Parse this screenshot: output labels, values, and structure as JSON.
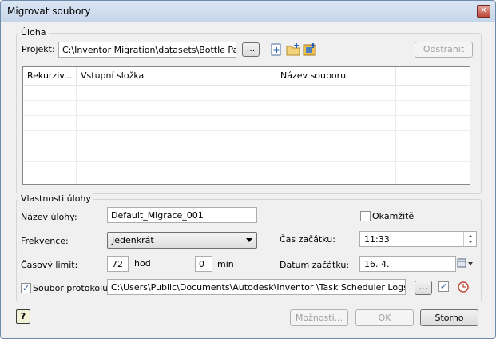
{
  "window": {
    "title": "Migrovat soubory",
    "close_glyph": "✕"
  },
  "task_group": {
    "label": "Úloha",
    "project_label": "Projekt:",
    "project_value": "C:\\Inventor Migration\\datasets\\Bottle Packag",
    "browse_label": "...",
    "remove_label": "Odstranit",
    "icons": [
      "add-file-icon",
      "add-folder-icon",
      "add-project-icon"
    ]
  },
  "table": {
    "columns": [
      "Rekurziv...",
      "Vstupní složka",
      "Název souboru",
      ""
    ],
    "rows": []
  },
  "properties": {
    "label": "Vlastnosti úlohy",
    "task_name_label": "Název úlohy:",
    "task_name_value": "Default_Migrace_001",
    "immediately_label": "Okamžitě",
    "frequency_label": "Frekvence:",
    "frequency_value": "Jedenkrát",
    "start_time_label": "Čas začátku:",
    "start_time_value": "11:33",
    "time_limit_label": "Časový limit:",
    "hours_value": "72",
    "hours_label": "hod",
    "minutes_value": "0",
    "minutes_label": "min",
    "start_date_label": "Datum začátku:",
    "start_date_value": "16.  4.",
    "log_label": "Soubor protokolu:",
    "log_value": "C:\\Users\\Public\\Documents\\Autodesk\\Inventor                \\Task Scheduler Logs &",
    "log_browse_label": "...",
    "check_glyph": "✓"
  },
  "footer": {
    "help_glyph": "?",
    "options_label": "Možnosti...",
    "ok_label": "OK",
    "cancel_label": "Storno"
  }
}
